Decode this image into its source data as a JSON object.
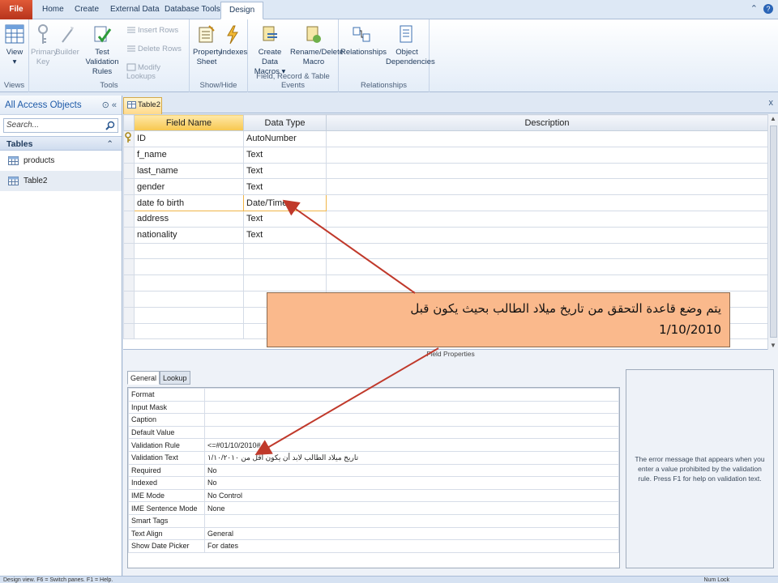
{
  "tabs": [
    "File",
    "Home",
    "Create",
    "External Data",
    "Database Tools",
    "Design"
  ],
  "ribbon": {
    "views": {
      "view": "View",
      "group": "Views"
    },
    "tools": {
      "primary_key": "Primary Key",
      "builder": "Builder",
      "test_validation_rules": "Test Validation Rules",
      "insert_rows": "Insert Rows",
      "delete_rows": "Delete Rows",
      "modify_lookups": "Modify Lookups",
      "group": "Tools"
    },
    "show_hide": {
      "property_sheet": "Property Sheet",
      "indexes": "Indexes",
      "group": "Show/Hide"
    },
    "events": {
      "create_data_macros": "Create Data Macros",
      "rename_delete_macro": "Rename/Delete Macro",
      "group": "Field, Record & Table Events"
    },
    "relationships": {
      "relationships": "Relationships",
      "object_dependencies": "Object Dependencies",
      "group": "Relationships"
    }
  },
  "nav": {
    "title": "All Access Objects",
    "search_placeholder": "Search...",
    "group": "Tables",
    "items": [
      "products",
      "Table2"
    ]
  },
  "document_tab": "Table2",
  "design_grid": {
    "headers": [
      "Field Name",
      "Data Type",
      "Description"
    ],
    "rows": [
      {
        "name": "ID",
        "type": "AutoNumber",
        "description": ""
      },
      {
        "name": "f_name",
        "type": "Text",
        "description": ""
      },
      {
        "name": "last_name",
        "type": "Text",
        "description": ""
      },
      {
        "name": "gender",
        "type": "Text",
        "description": ""
      },
      {
        "name": "date fo birth",
        "type": "Date/Time",
        "description": ""
      },
      {
        "name": "address",
        "type": "Text",
        "description": ""
      },
      {
        "name": "nationality",
        "type": "Text",
        "description": ""
      }
    ]
  },
  "callout": {
    "line1": "يتم وضع قاعدة التحقق من تاريخ ميلاد الطالب بحيث يكون قبل",
    "line2": "1/10/2010"
  },
  "field_properties": {
    "title": "Field Properties",
    "tabs": [
      "General",
      "Lookup"
    ],
    "rows": [
      {
        "name": "Format",
        "value": ""
      },
      {
        "name": "Input Mask",
        "value": ""
      },
      {
        "name": "Caption",
        "value": ""
      },
      {
        "name": "Default Value",
        "value": ""
      },
      {
        "name": "Validation Rule",
        "value": "<=#01/10/2010#"
      },
      {
        "name": "Validation Text",
        "value": "تاريخ ميلاد الطالب لابد أن يكون أقل من ١/١٠/٢٠١٠"
      },
      {
        "name": "Required",
        "value": "No"
      },
      {
        "name": "Indexed",
        "value": "No"
      },
      {
        "name": "IME Mode",
        "value": "No Control"
      },
      {
        "name": "IME Sentence Mode",
        "value": "None"
      },
      {
        "name": "Smart Tags",
        "value": ""
      },
      {
        "name": "Text Align",
        "value": "General"
      },
      {
        "name": "Show Date Picker",
        "value": "For dates"
      }
    ],
    "help": "The error message that appears when you enter a value prohibited by the validation rule. Press F1 for help on validation text."
  },
  "status": {
    "left": "Design view.  F6 = Switch panes.  F1 = Help.",
    "right": "Num Lock"
  },
  "colors": {
    "file_tab": "#c9421f",
    "callout": "#fab98c",
    "arrow": "#c0392b",
    "active_header": "#f7c64d"
  }
}
